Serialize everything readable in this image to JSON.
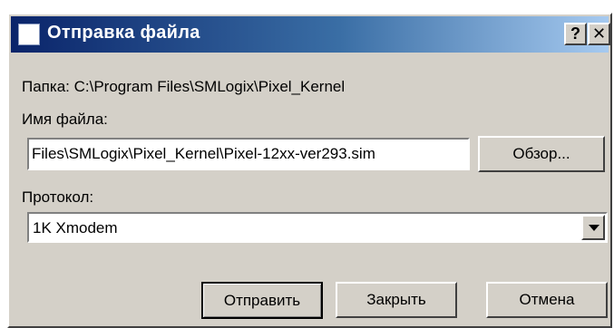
{
  "window": {
    "title": "Отправка файла",
    "help_label": "?",
    "close_label": "✕",
    "colors": {
      "face": "#d4d0c8",
      "title_start": "#0a246a",
      "title_end": "#a6caf0",
      "title_text": "#ffffff"
    }
  },
  "folder": {
    "label": "Папка: C:\\Program Files\\SMLogix\\Pixel_Kernel"
  },
  "filename": {
    "label": "Имя файла:",
    "value": "Files\\SMLogix\\Pixel_Kernel\\Pixel-12xx-ver293.sim",
    "browse_label": "Обзор..."
  },
  "protocol": {
    "label": "Протокол:",
    "selected": "1K Xmodem"
  },
  "buttons": {
    "send": "Отправить",
    "close": "Закрыть",
    "cancel": "Отмена"
  },
  "icons": {
    "window_icon": "window-icon",
    "dropdown": "chevron-down-icon"
  }
}
